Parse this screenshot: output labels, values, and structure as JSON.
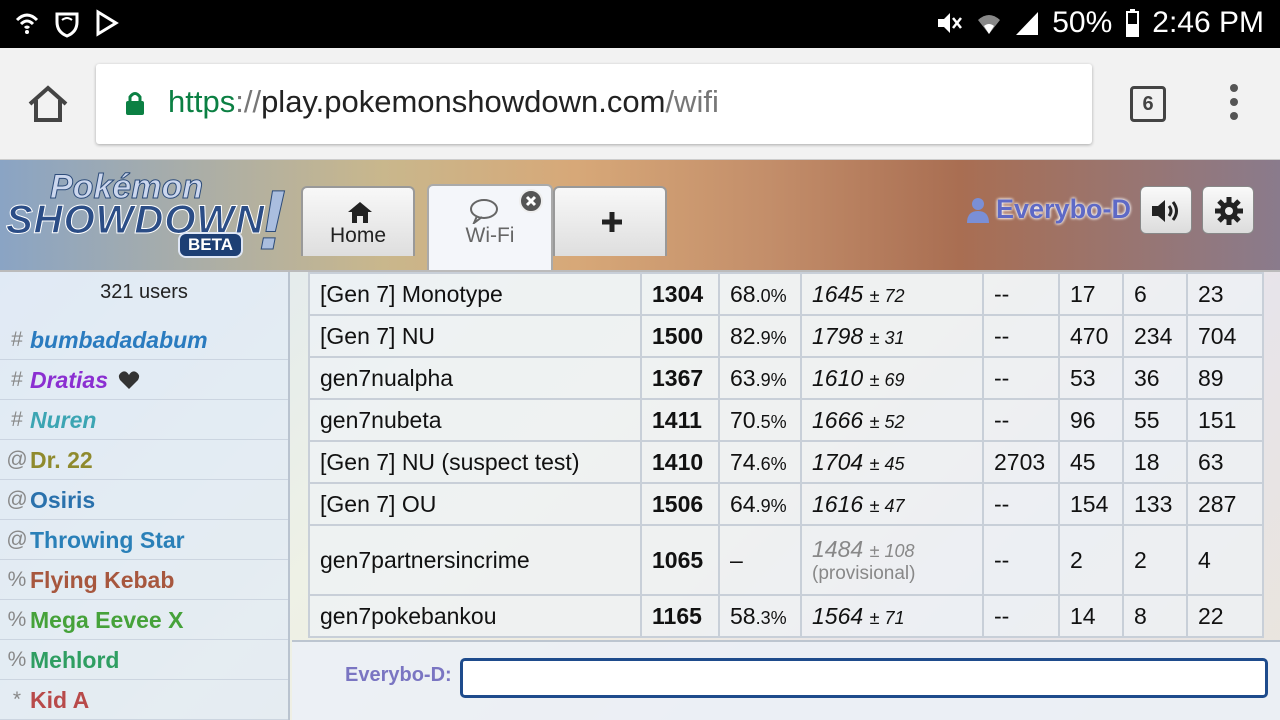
{
  "status_bar": {
    "battery": "50%",
    "time": "2:46 PM"
  },
  "browser": {
    "url_scheme": "https",
    "url_sep": "://",
    "url_host": "play.pokemonshowdown.com",
    "url_path": "/wifi",
    "tab_count": "6"
  },
  "header": {
    "logo_top": "Pokémon",
    "logo_main": "SHOWDOWN",
    "logo_beta": "BETA",
    "logo_bang": "!",
    "tabs": [
      {
        "label": "Home",
        "icon": "home-icon"
      },
      {
        "label": "Wi-Fi",
        "icon": "chat-bubble-icon"
      },
      {
        "label": "",
        "icon": "plus-icon"
      }
    ],
    "username": "Everybo-D",
    "colors": {
      "username": "#5e69c6"
    }
  },
  "userlist": {
    "count": "321 users",
    "users": [
      {
        "rank": "#",
        "name": "bumbadadabum",
        "color": "#2a7bbf",
        "italic": true
      },
      {
        "rank": "#",
        "name": "Dratias",
        "color": "#8b2fd1",
        "italic": true,
        "heart": true
      },
      {
        "rank": "#",
        "name": "Nuren",
        "color": "#3ca5b3",
        "italic": true
      },
      {
        "rank": "@",
        "name": "Dr. 22",
        "color": "#8f8a2d",
        "italic": false
      },
      {
        "rank": "@",
        "name": "Osiris",
        "color": "#2a71ac",
        "italic": false
      },
      {
        "rank": "@",
        "name": "Throwing Star",
        "color": "#2a80b8",
        "italic": false
      },
      {
        "rank": "%",
        "name": "Flying Kebab",
        "color": "#a7573e",
        "italic": false
      },
      {
        "rank": "%",
        "name": "Mega Eevee X",
        "color": "#46a23a",
        "italic": false
      },
      {
        "rank": "%",
        "name": "Mehlord",
        "color": "#2f9e62",
        "italic": false
      },
      {
        "rank": "*",
        "name": "Kid A",
        "color": "#b84a4a",
        "italic": false
      }
    ]
  },
  "ladder": {
    "rows": [
      {
        "format": "[Gen 7] Monotype",
        "elo": "1304",
        "gxe": "68",
        "gxe_dec": ".0%",
        "glicko": "1645",
        "glicko_dev": "± 72",
        "coil": "--",
        "w": "17",
        "l": "6",
        "t": "23"
      },
      {
        "format": "[Gen 7] NU",
        "elo": "1500",
        "gxe": "82",
        "gxe_dec": ".9%",
        "glicko": "1798",
        "glicko_dev": "± 31",
        "coil": "--",
        "w": "470",
        "l": "234",
        "t": "704"
      },
      {
        "format": "gen7nualpha",
        "elo": "1367",
        "gxe": "63",
        "gxe_dec": ".9%",
        "glicko": "1610",
        "glicko_dev": "± 69",
        "coil": "--",
        "w": "53",
        "l": "36",
        "t": "89"
      },
      {
        "format": "gen7nubeta",
        "elo": "1411",
        "gxe": "70",
        "gxe_dec": ".5%",
        "glicko": "1666",
        "glicko_dev": "± 52",
        "coil": "--",
        "w": "96",
        "l": "55",
        "t": "151"
      },
      {
        "format": "[Gen 7] NU (suspect test)",
        "elo": "1410",
        "gxe": "74",
        "gxe_dec": ".6%",
        "glicko": "1704",
        "glicko_dev": "± 45",
        "coil": "2703",
        "w": "45",
        "l": "18",
        "t": "63"
      },
      {
        "format": "[Gen 7] OU",
        "elo": "1506",
        "gxe": "64",
        "gxe_dec": ".9%",
        "glicko": "1616",
        "glicko_dev": "± 47",
        "coil": "--",
        "w": "154",
        "l": "133",
        "t": "287"
      },
      {
        "format": "gen7partnersincrime",
        "elo": "1065",
        "gxe": "–",
        "gxe_dec": "",
        "glicko": "1484",
        "glicko_dev": "± 108",
        "glicko_note": "(provisional)",
        "coil": "--",
        "w": "2",
        "l": "2",
        "t": "4"
      },
      {
        "format": "gen7pokebankou",
        "elo": "1165",
        "gxe": "58",
        "gxe_dec": ".3%",
        "glicko": "1564",
        "glicko_dev": "± 71",
        "coil": "--",
        "w": "14",
        "l": "8",
        "t": "22"
      }
    ]
  },
  "chat": {
    "user_label": "Everybo-D:",
    "input_value": ""
  }
}
